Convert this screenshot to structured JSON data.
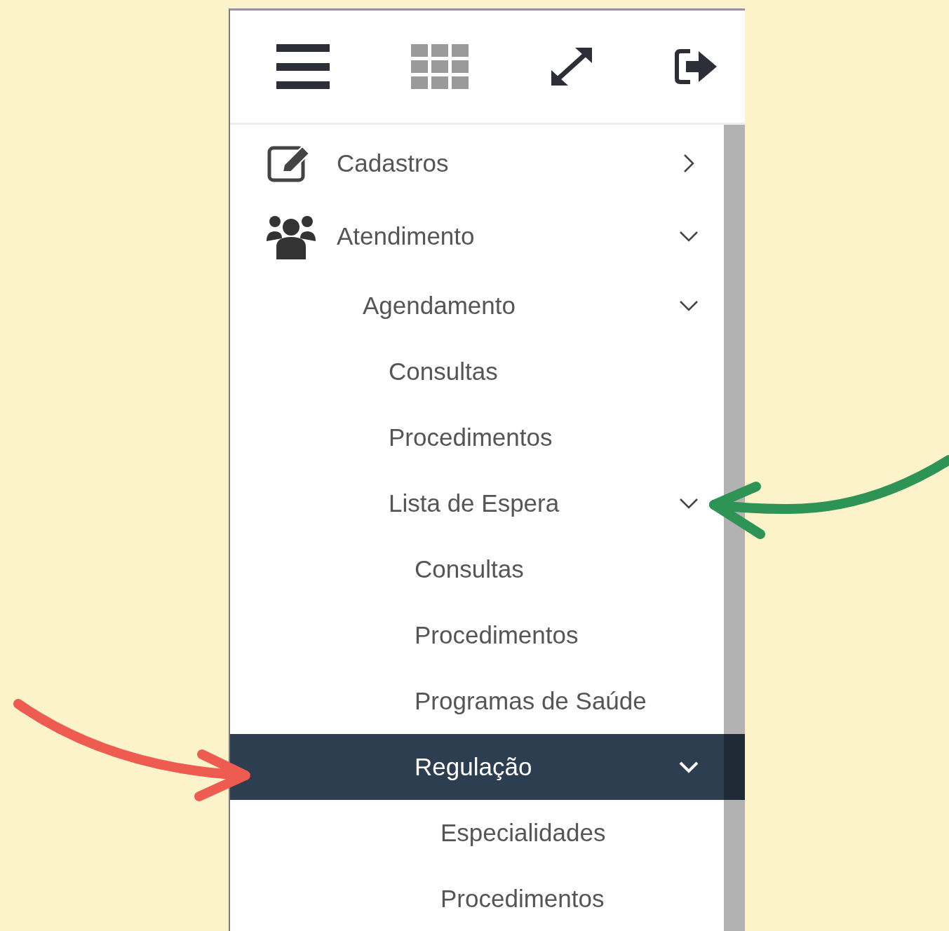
{
  "menu": [
    {
      "label": "Cadastros",
      "expanded": false,
      "selected": false
    },
    {
      "label": "Atendimento",
      "expanded": true,
      "selected": false,
      "children": [
        {
          "label": "Agendamento",
          "expanded": true,
          "selected": false,
          "children": [
            {
              "label": "Consultas",
              "selected": false
            },
            {
              "label": "Procedimentos",
              "selected": false
            },
            {
              "label": "Lista de Espera",
              "expanded": true,
              "selected": false,
              "children": [
                {
                  "label": "Consultas",
                  "selected": false
                },
                {
                  "label": "Procedimentos",
                  "selected": false
                },
                {
                  "label": "Programas de Saúde",
                  "selected": false
                },
                {
                  "label": "Regulação",
                  "expanded": true,
                  "selected": true,
                  "children": [
                    {
                      "label": "Especialidades",
                      "selected": false
                    },
                    {
                      "label": "Procedimentos",
                      "selected": false
                    }
                  ]
                }
              ]
            }
          ]
        }
      ]
    }
  ]
}
